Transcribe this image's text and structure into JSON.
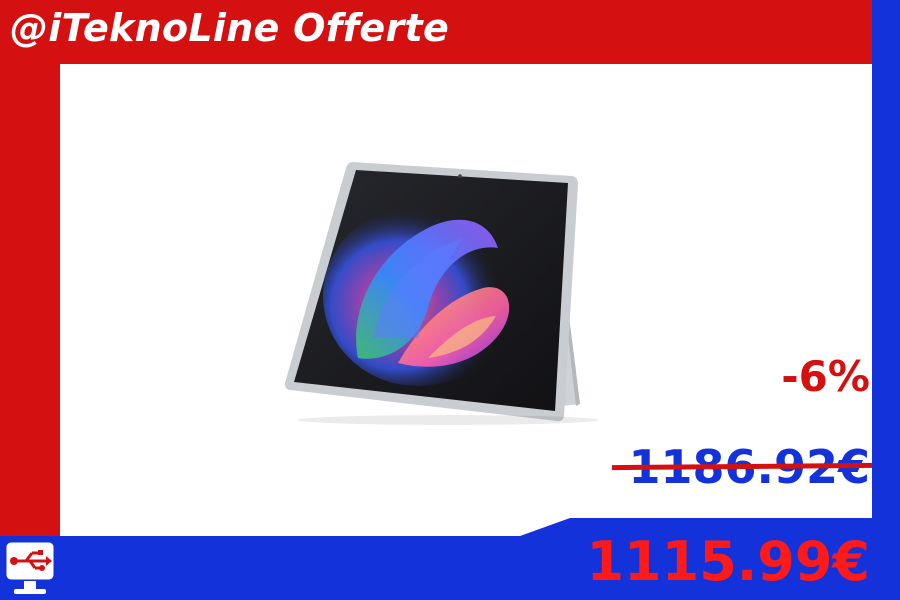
{
  "header": {
    "brand": "@iTeknoLine Offerte"
  },
  "deal": {
    "discount": "-6%",
    "old_price": "1186.92€",
    "new_price": "1115.99€"
  },
  "product_image": {
    "description_icon": "tablet-icon"
  },
  "logo": {
    "icon": "usb-monitor-icon"
  },
  "colors": {
    "red": "#d51010",
    "blue": "#1432d9",
    "price_red": "#ff1a1a",
    "white": "#ffffff"
  }
}
